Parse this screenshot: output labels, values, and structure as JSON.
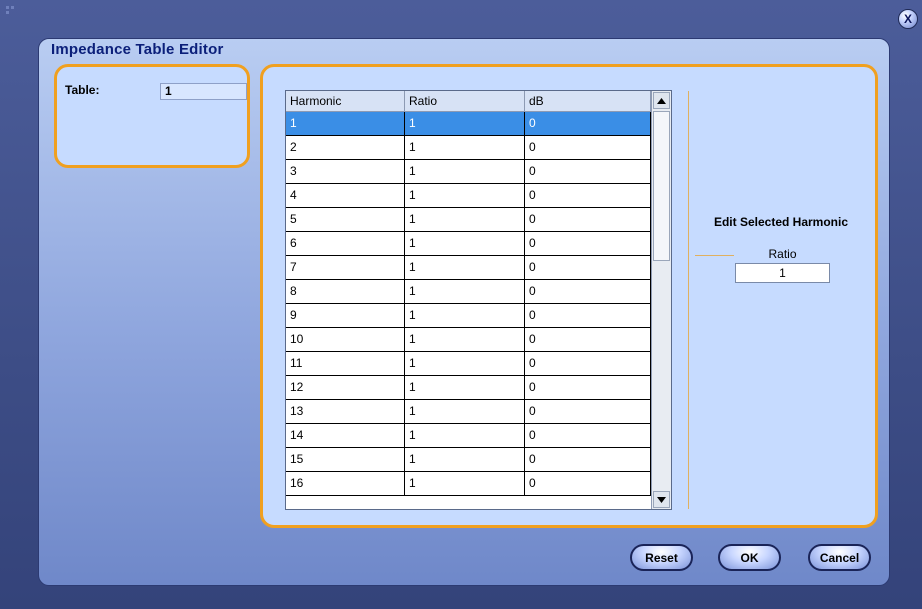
{
  "window": {
    "close_label": "X"
  },
  "dialog": {
    "title": "Impedance Table Editor"
  },
  "table_selector": {
    "label": "Table:",
    "value": "1"
  },
  "grid": {
    "columns": [
      "Harmonic",
      "Ratio",
      "dB"
    ],
    "selected_row": 0,
    "rows": [
      [
        "1",
        "1",
        "0"
      ],
      [
        "2",
        "1",
        "0"
      ],
      [
        "3",
        "1",
        "0"
      ],
      [
        "4",
        "1",
        "0"
      ],
      [
        "5",
        "1",
        "0"
      ],
      [
        "6",
        "1",
        "0"
      ],
      [
        "7",
        "1",
        "0"
      ],
      [
        "8",
        "1",
        "0"
      ],
      [
        "9",
        "1",
        "0"
      ],
      [
        "10",
        "1",
        "0"
      ],
      [
        "11",
        "1",
        "0"
      ],
      [
        "12",
        "1",
        "0"
      ],
      [
        "13",
        "1",
        "0"
      ],
      [
        "14",
        "1",
        "0"
      ],
      [
        "15",
        "1",
        "0"
      ],
      [
        "16",
        "1",
        "0"
      ]
    ],
    "scroll_up_icon": "arrow-up",
    "scroll_down_icon": "arrow-down"
  },
  "edit": {
    "heading": "Edit Selected Harmonic",
    "ratio_label": "Ratio",
    "ratio_value": "1"
  },
  "buttons": {
    "reset": "Reset",
    "ok": "OK",
    "cancel": "Cancel"
  },
  "colors": {
    "accent_border": "#f0a020",
    "selection": "#3a8ee6",
    "title_text": "#0b1f7a"
  }
}
